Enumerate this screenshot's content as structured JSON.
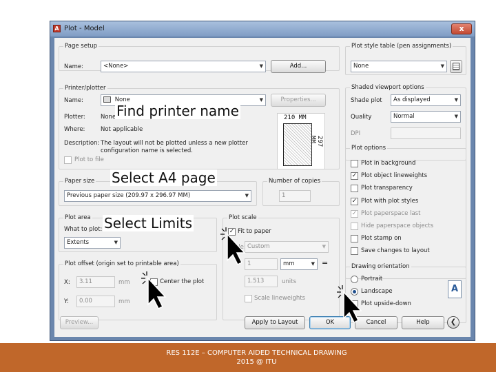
{
  "window": {
    "title": "Plot - Model",
    "close_glyph": "x"
  },
  "page_setup": {
    "group_title": "Page setup",
    "name_label": "Name:",
    "name_value": "<None>",
    "add_button": "Add..."
  },
  "printer": {
    "group_title": "Printer/plotter",
    "name_label": "Name:",
    "name_value": "None",
    "properties_button": "Properties...",
    "plotter_label": "Plotter:",
    "plotter_value": "None",
    "where_label": "Where:",
    "where_value": "Not applicable",
    "description_label": "Description:",
    "description_line1": "The layout will not be plotted unless a new plotter",
    "description_line2": "configuration name is selected.",
    "plot_to_file": "Plot to file",
    "paper_width": "210 MM",
    "paper_height": "297 MM"
  },
  "paper_size": {
    "group_title": "Paper size",
    "value": "Previous paper size (209.97 x 296.97 MM)"
  },
  "copies": {
    "group_title": "Number of copies",
    "value": "1"
  },
  "plot_area": {
    "group_title": "Plot area",
    "what_to_plot_label": "What to plot:",
    "what_to_plot_value": "Extents"
  },
  "plot_offset": {
    "group_title": "Plot offset (origin set to printable area)",
    "x_label": "X:",
    "x_value": "3.11",
    "x_unit": "mm",
    "y_label": "Y:",
    "y_value": "0.00",
    "y_unit": "mm",
    "center_label": "Center the plot"
  },
  "plot_scale": {
    "group_title": "Plot scale",
    "fit_to_paper": "Fit to paper",
    "scale_label": "Scale:",
    "scale_value": "Custom",
    "top_value": "1",
    "top_unit": "mm",
    "equals": "=",
    "bottom_value": "1.513",
    "bottom_unit": "units",
    "scale_lineweights": "Scale lineweights"
  },
  "plot_style_table": {
    "group_title": "Plot style table (pen assignments)",
    "value": "None"
  },
  "shaded_viewport": {
    "group_title": "Shaded viewport options",
    "shade_plot_label": "Shade plot",
    "shade_plot_value": "As displayed",
    "quality_label": "Quality",
    "quality_value": "Normal",
    "dpi_label": "DPI"
  },
  "plot_options": {
    "group_title": "Plot options",
    "items": [
      {
        "label": "Plot in background",
        "checked": false,
        "disabled": false
      },
      {
        "label": "Plot object lineweights",
        "checked": true,
        "disabled": false
      },
      {
        "label": "Plot transparency",
        "checked": false,
        "disabled": false
      },
      {
        "label": "Plot with plot styles",
        "checked": true,
        "disabled": false
      },
      {
        "label": "Plot paperspace last",
        "checked": true,
        "disabled": true
      },
      {
        "label": "Hide paperspace objects",
        "checked": false,
        "disabled": true
      },
      {
        "label": "Plot stamp on",
        "checked": false,
        "disabled": false
      },
      {
        "label": "Save changes to layout",
        "checked": false,
        "disabled": false
      }
    ]
  },
  "drawing_orientation": {
    "group_title": "Drawing orientation",
    "portrait": "Portrait",
    "landscape": "Landscape",
    "upside_down": "Plot upside-down",
    "orientation_icon": "A"
  },
  "buttons": {
    "preview": "Preview...",
    "apply": "Apply to Layout",
    "ok": "OK",
    "cancel": "Cancel",
    "help": "Help"
  },
  "annotations": {
    "printer": "Find printer name",
    "paper": "Select A4 page",
    "limits": "Select Limits"
  },
  "footer": {
    "line1": "RES 112E – COMPUTER AIDED TECHNICAL DRAWING",
    "line2": "2015 @ ITU"
  },
  "colors": {
    "footer_bg": "#c0672a",
    "title_bar": "#8fa9cf"
  }
}
